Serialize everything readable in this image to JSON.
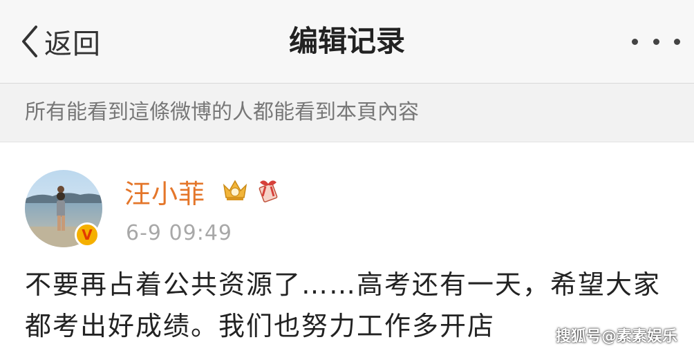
{
  "nav": {
    "back_label": "返回",
    "title": "编辑记录"
  },
  "notice": {
    "text": "所有能看到這條微博的人都能看到本頁內容"
  },
  "post": {
    "username": "汪小菲",
    "verified_mark": "V",
    "timestamp": "6-9 09:49",
    "content": "不要再占着公共资源了……高考还有一天，希望大家都考出好成绩。我们也努力工作多开店"
  },
  "watermark": "搜狐号@素素娱乐",
  "colors": {
    "username": "#e4762a",
    "verified_bg": "#f5b000",
    "timestamp": "#a8a8a8",
    "nav_bg": "#f7f7f7",
    "notice_bg": "#f2f2f2"
  },
  "icons": {
    "back": "chevron-left-icon",
    "more": "more-dots-icon",
    "crown": "vip-crown-icon",
    "gift": "gift-badge-icon"
  }
}
